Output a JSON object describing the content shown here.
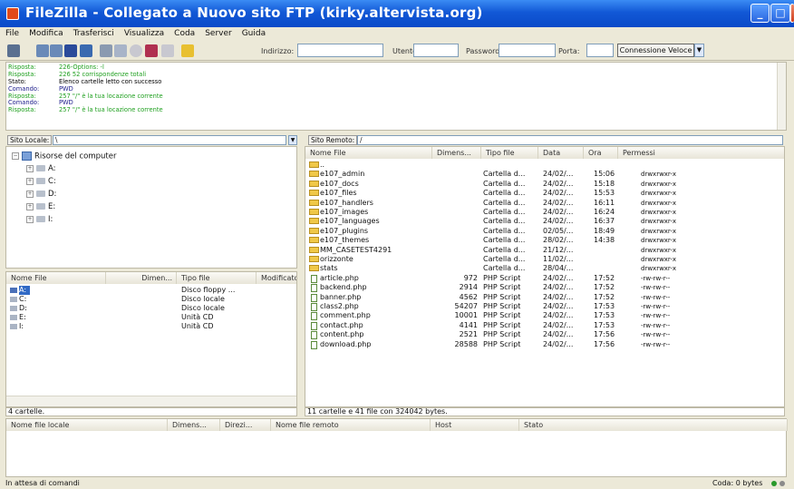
{
  "window": {
    "title": "FileZilla - Collegato a Nuovo sito FTP (kirky.altervista.org)",
    "min_glyph": "_",
    "max_glyph": "□",
    "close_glyph": "X"
  },
  "menu": [
    "File",
    "Modifica",
    "Trasferisci",
    "Visualizza",
    "Coda",
    "Server",
    "Guida"
  ],
  "quickconnect": {
    "host_label": "Indirizzo:",
    "user_label": "Utente:",
    "password_label": "Password:",
    "port_label": "Porta:",
    "connect_button": "Connessione Veloce"
  },
  "log": [
    {
      "k": "Risposta:",
      "v": "226-Options: -l",
      "color": "#20a020"
    },
    {
      "k": "Risposta:",
      "v": "226 52 corrispondenze totali",
      "color": "#20a020"
    },
    {
      "k": "Stato:",
      "v": "Elenco cartelle letto con successo",
      "color": "#000000"
    },
    {
      "k": "Comando:",
      "v": "PWD",
      "color": "#1a1a8a"
    },
    {
      "k": "Risposta:",
      "v": "257 \"/\" è la tua locazione corrente",
      "color": "#20a020"
    },
    {
      "k": "Comando:",
      "v": "PWD",
      "color": "#1a1a8a"
    },
    {
      "k": "Risposta:",
      "v": "257 \"/\" è la tua locazione corrente",
      "color": "#20a020"
    }
  ],
  "local": {
    "site_label": "Sito Locale:",
    "path": "\\",
    "tree_root": "Risorse del computer",
    "tree_drives": [
      "A:",
      "C:",
      "D:",
      "E:",
      "I:"
    ],
    "headers": [
      "Nome File",
      "Dimen...",
      "Tipo file",
      "Modificato"
    ],
    "files": [
      {
        "name": "A:",
        "type": "Disco floppy ..."
      },
      {
        "name": "C:",
        "type": "Disco locale"
      },
      {
        "name": "D:",
        "type": "Disco locale"
      },
      {
        "name": "E:",
        "type": "Unità CD"
      },
      {
        "name": "I:",
        "type": "Unità CD"
      }
    ],
    "status": "4 cartelle."
  },
  "remote": {
    "site_label": "Sito Remoto:",
    "path": "/",
    "headers": [
      "Nome File",
      "Dimens...",
      "Tipo file",
      "Data",
      "Ora",
      "Permessi"
    ],
    "files": [
      {
        "name": "..",
        "size": "",
        "type": "",
        "date": "",
        "time": "",
        "perm": "",
        "kind": "folder"
      },
      {
        "name": "e107_admin",
        "size": "",
        "type": "Cartella d...",
        "date": "24/02/...",
        "time": "15:06",
        "perm": "drwxrwxr-x",
        "kind": "folder"
      },
      {
        "name": "e107_docs",
        "size": "",
        "type": "Cartella d...",
        "date": "24/02/...",
        "time": "15:18",
        "perm": "drwxrwxr-x",
        "kind": "folder"
      },
      {
        "name": "e107_files",
        "size": "",
        "type": "Cartella d...",
        "date": "24/02/...",
        "time": "15:53",
        "perm": "drwxrwxr-x",
        "kind": "folder"
      },
      {
        "name": "e107_handlers",
        "size": "",
        "type": "Cartella d...",
        "date": "24/02/...",
        "time": "16:11",
        "perm": "drwxrwxr-x",
        "kind": "folder"
      },
      {
        "name": "e107_images",
        "size": "",
        "type": "Cartella d...",
        "date": "24/02/...",
        "time": "16:24",
        "perm": "drwxrwxr-x",
        "kind": "folder"
      },
      {
        "name": "e107_languages",
        "size": "",
        "type": "Cartella d...",
        "date": "24/02/...",
        "time": "16:37",
        "perm": "drwxrwxr-x",
        "kind": "folder"
      },
      {
        "name": "e107_plugins",
        "size": "",
        "type": "Cartella d...",
        "date": "02/05/...",
        "time": "18:49",
        "perm": "drwxrwxr-x",
        "kind": "folder"
      },
      {
        "name": "e107_themes",
        "size": "",
        "type": "Cartella d...",
        "date": "28/02/...",
        "time": "14:38",
        "perm": "drwxrwxr-x",
        "kind": "folder"
      },
      {
        "name": "MM_CASETEST4291",
        "size": "",
        "type": "Cartella d...",
        "date": "21/12/...",
        "time": "",
        "perm": "drwxrwxr-x",
        "kind": "folder"
      },
      {
        "name": "orizzonte",
        "size": "",
        "type": "Cartella d...",
        "date": "11/02/...",
        "time": "",
        "perm": "drwxrwxr-x",
        "kind": "folder"
      },
      {
        "name": "stats",
        "size": "",
        "type": "Cartella d...",
        "date": "28/04/...",
        "time": "",
        "perm": "drwxrwxr-x",
        "kind": "folder"
      },
      {
        "name": "article.php",
        "size": "972",
        "type": "PHP Script",
        "date": "24/02/...",
        "time": "17:52",
        "perm": "-rw-rw-r--",
        "kind": "php"
      },
      {
        "name": "backend.php",
        "size": "2914",
        "type": "PHP Script",
        "date": "24/02/...",
        "time": "17:52",
        "perm": "-rw-rw-r--",
        "kind": "php"
      },
      {
        "name": "banner.php",
        "size": "4562",
        "type": "PHP Script",
        "date": "24/02/...",
        "time": "17:52",
        "perm": "-rw-rw-r--",
        "kind": "php"
      },
      {
        "name": "class2.php",
        "size": "54207",
        "type": "PHP Script",
        "date": "24/02/...",
        "time": "17:53",
        "perm": "-rw-rw-r--",
        "kind": "php"
      },
      {
        "name": "comment.php",
        "size": "10001",
        "type": "PHP Script",
        "date": "24/02/...",
        "time": "17:53",
        "perm": "-rw-rw-r--",
        "kind": "php"
      },
      {
        "name": "contact.php",
        "size": "4141",
        "type": "PHP Script",
        "date": "24/02/...",
        "time": "17:53",
        "perm": "-rw-rw-r--",
        "kind": "php"
      },
      {
        "name": "content.php",
        "size": "2521",
        "type": "PHP Script",
        "date": "24/02/...",
        "time": "17:56",
        "perm": "-rw-rw-r--",
        "kind": "php"
      },
      {
        "name": "download.php",
        "size": "28588",
        "type": "PHP Script",
        "date": "24/02/...",
        "time": "17:56",
        "perm": "-rw-rw-r--",
        "kind": "php"
      }
    ],
    "status": "11 cartelle e 41 file con 324042 bytes."
  },
  "queue": {
    "headers": [
      "Nome file locale",
      "Dimens...",
      "Direzi...",
      "Nome file remoto",
      "Host",
      "Stato"
    ]
  },
  "statusbar": {
    "left": "In attesa di comandi",
    "right": "Coda: 0 bytes"
  }
}
